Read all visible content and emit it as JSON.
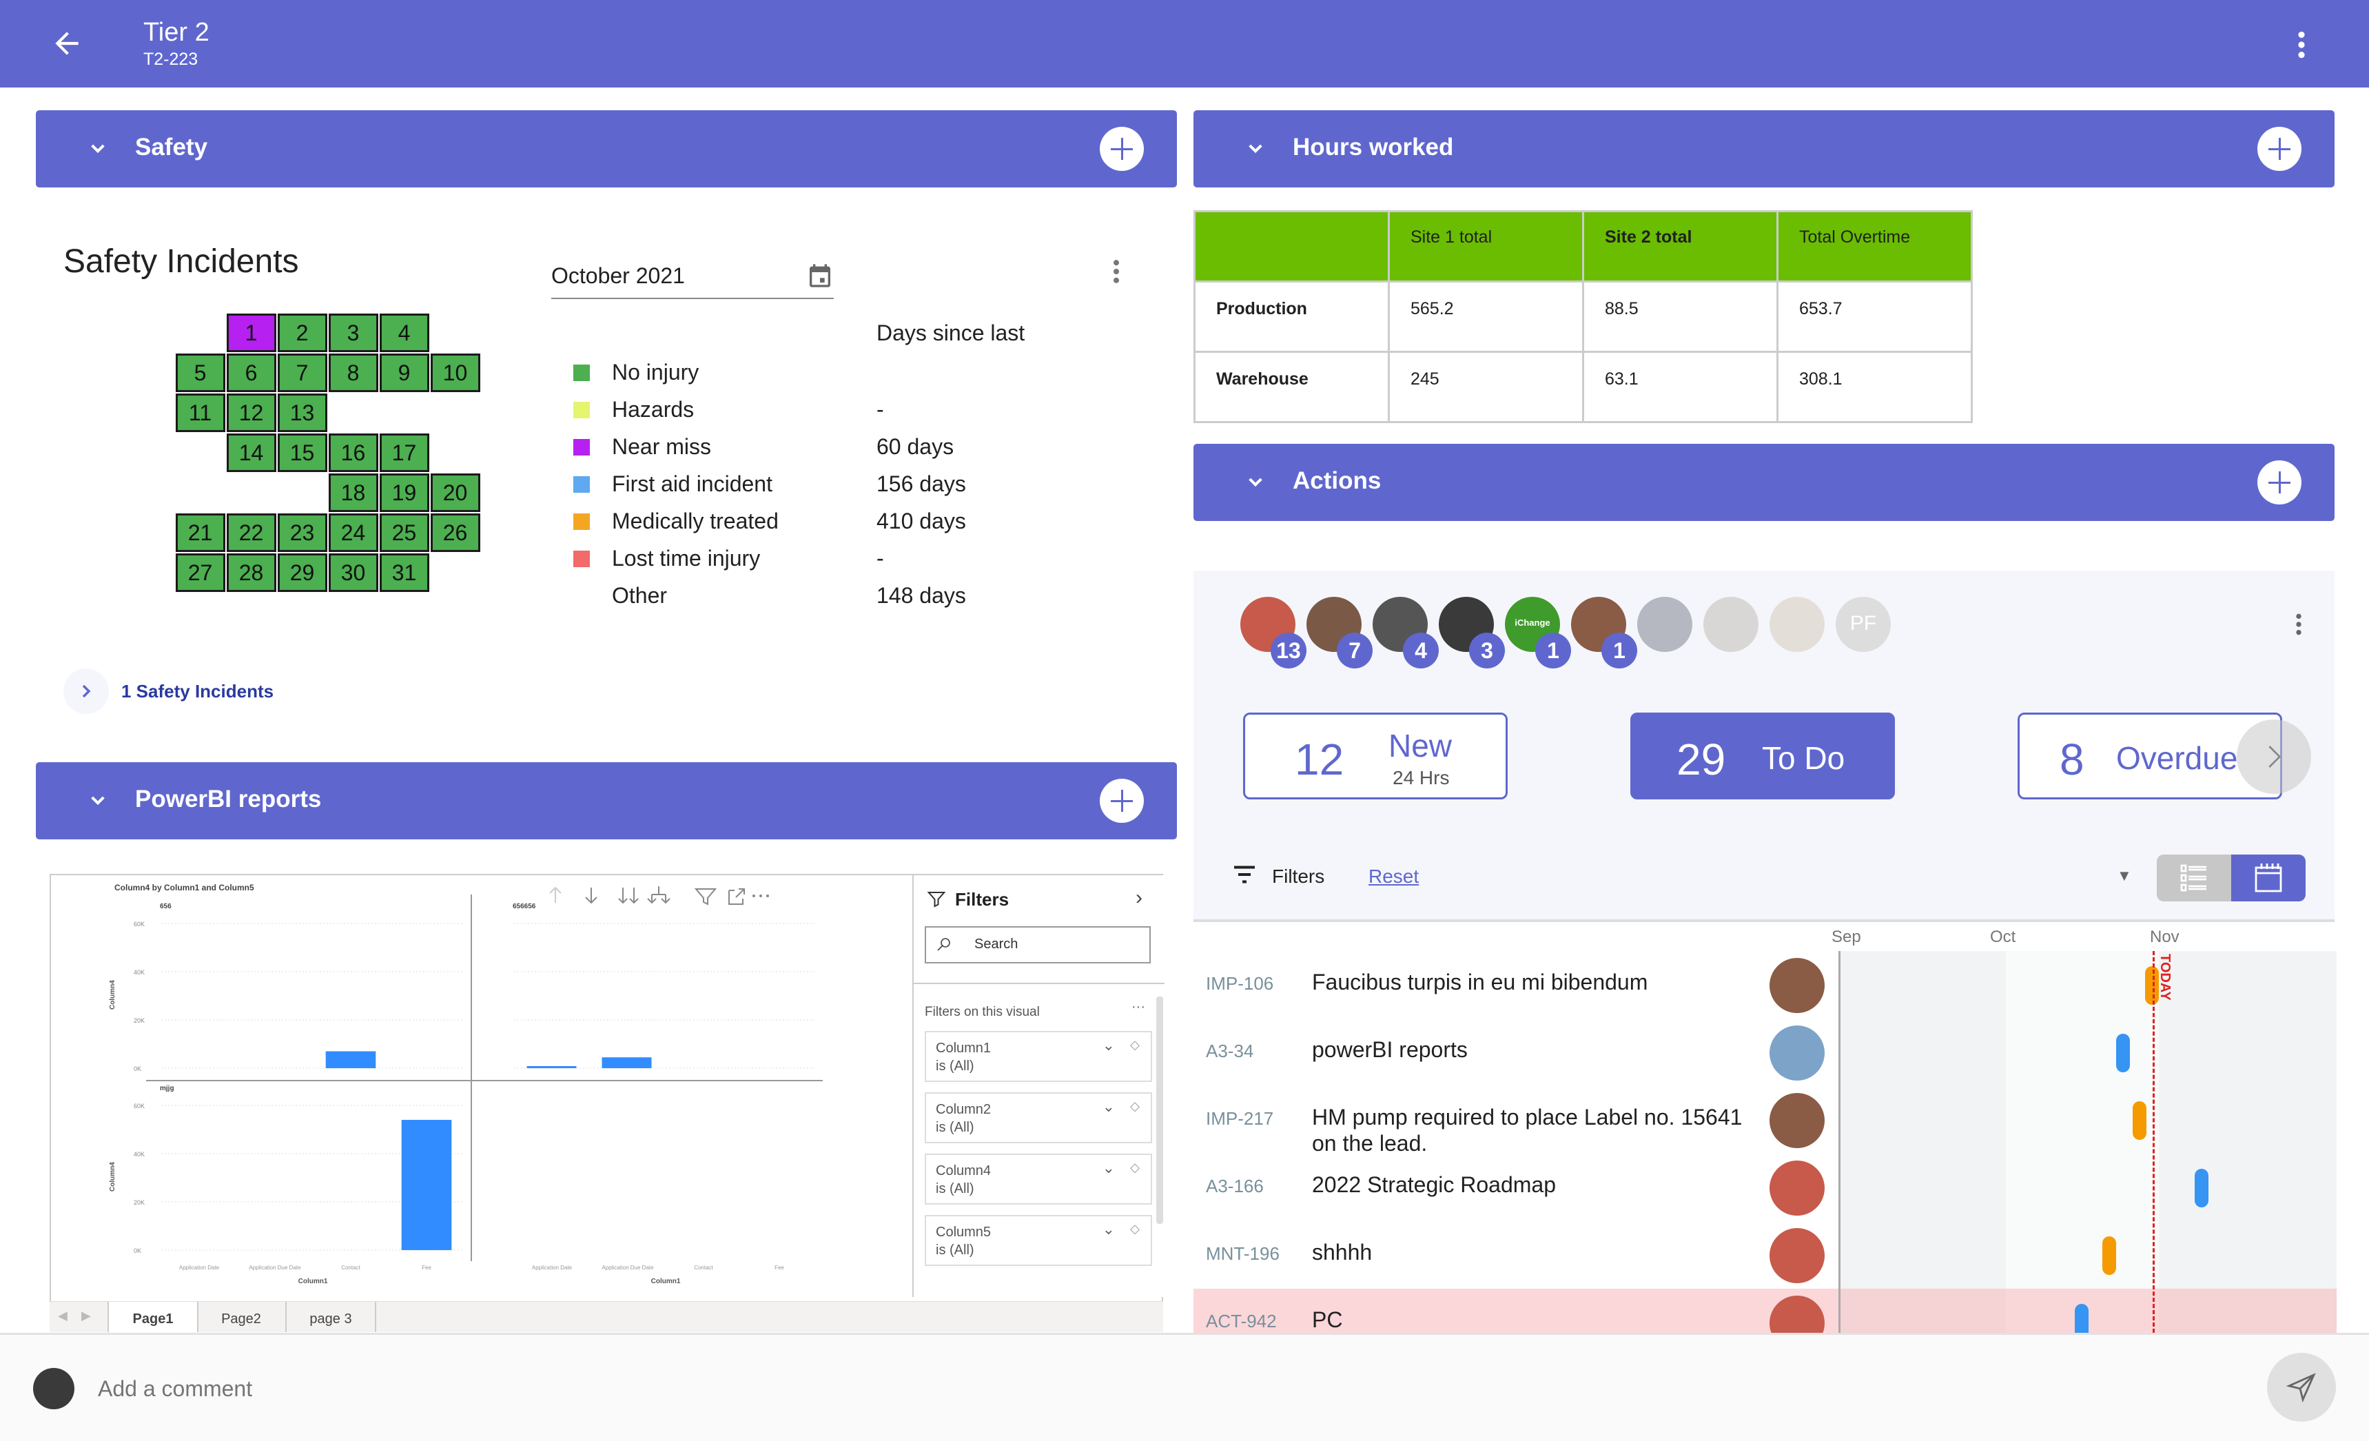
{
  "header": {
    "title": "Tier 2",
    "subtitle": "T2-223"
  },
  "sections": {
    "safety": "Safety",
    "hours": "Hours worked",
    "powerbi": "PowerBI reports",
    "actions": "Actions"
  },
  "safety": {
    "title": "Safety Incidents",
    "month": "October 2021",
    "days_since_header": "Days since last",
    "legend": [
      {
        "name": "No injury",
        "color": "#4caf50",
        "days": ""
      },
      {
        "name": "Hazards",
        "color": "#e6f56e",
        "days": "-"
      },
      {
        "name": "Near miss",
        "color": "#b620f0",
        "days": "60 days"
      },
      {
        "name": "First aid incident",
        "color": "#5ea9ef",
        "days": "156 days"
      },
      {
        "name": "Medically treated",
        "color": "#f4a623",
        "days": "410 days"
      },
      {
        "name": "Lost time injury",
        "color": "#f26a6a",
        "days": "-"
      },
      {
        "name": "Other",
        "color": "",
        "days": "148 days"
      }
    ],
    "days": [
      "1",
      "2",
      "3",
      "4",
      "5",
      "6",
      "7",
      "8",
      "9",
      "10",
      "11",
      "12",
      "13",
      "14",
      "15",
      "16",
      "17",
      "18",
      "19",
      "20",
      "21",
      "22",
      "23",
      "24",
      "25",
      "26",
      "27",
      "28",
      "29",
      "30",
      "31"
    ],
    "highlighted_day": {
      "day": "1",
      "category": "Near miss"
    },
    "incidents_link": "1 Safety Incidents"
  },
  "hours_table": {
    "headers": [
      "",
      "Site 1 total",
      "Site 2 total",
      "Total Overtime"
    ],
    "rows": [
      [
        "Production",
        "565.2",
        "88.5",
        "653.7"
      ],
      [
        "Warehouse",
        "245",
        "63.1",
        "308.1"
      ]
    ]
  },
  "powerbi": {
    "chart_data": {
      "type": "bar",
      "title": "Column4 by Column1 and Column5",
      "xlabel": "Column1",
      "ylabel": "Column4",
      "categories": [
        "Application Date",
        "Application Due Date",
        "Contact",
        "Fee"
      ],
      "y_ticks": [
        "0K",
        "20K",
        "40K",
        "60K"
      ],
      "ylim": [
        0,
        60000
      ],
      "panels": [
        {
          "name": "656",
          "values": [
            0,
            0,
            7000,
            0
          ]
        },
        {
          "name": "656656",
          "values": [
            300,
            4500,
            0,
            0
          ]
        },
        {
          "name": "mjjg",
          "values": [
            0,
            0,
            0,
            54000
          ]
        }
      ]
    },
    "filters_title": "Filters",
    "search_placeholder": "Search",
    "filters_on_visual": "Filters on this visual",
    "filters": [
      {
        "name": "Column1",
        "state": "is (All)"
      },
      {
        "name": "Column2",
        "state": "is (All)"
      },
      {
        "name": "Column4",
        "state": "is (All)"
      },
      {
        "name": "Column5",
        "state": "is (All)"
      }
    ],
    "pages": [
      "Page1",
      "Page2",
      "page 3"
    ],
    "active_page": "Page1"
  },
  "actions": {
    "avatars": [
      {
        "count": "13",
        "color": "#c75a4a"
      },
      {
        "count": "7",
        "color": "#7a5a46"
      },
      {
        "count": "4",
        "color": "#555555"
      },
      {
        "count": "3",
        "color": "#3a3a3a"
      },
      {
        "count": "1",
        "color": "#3f9b2b",
        "label": "iChange"
      },
      {
        "count": "1",
        "color": "#8a5b45"
      },
      {
        "count": "",
        "color": "#8b8f99"
      },
      {
        "count": "",
        "color": "#c7c3bd"
      },
      {
        "count": "",
        "color": "#d9cfc2"
      },
      {
        "count": "",
        "color": "#dddddd",
        "initials": "PF"
      }
    ],
    "stats": {
      "new": {
        "count": "12",
        "label": "New",
        "sub": "24 Hrs"
      },
      "todo": {
        "count": "29",
        "label": "To Do"
      },
      "overdue": {
        "count": "8",
        "label": "Overdue"
      }
    },
    "filters_label": "Filters",
    "reset_label": "Reset",
    "months": [
      "Sep",
      "Oct",
      "Nov"
    ],
    "today_label": "TODAY",
    "items": [
      {
        "id": "IMP-106",
        "title": "Faucibus turpis in eu mi bibendum",
        "avatar": "#8a5b45",
        "bar_color": "#f59b00",
        "highlight": false
      },
      {
        "id": "A3-34",
        "title": "powerBI reports",
        "avatar": "#7da3c9",
        "bar_color": "#3694f3",
        "highlight": false
      },
      {
        "id": "IMP-217",
        "title": "HM pump required to place Label no. 15641 on the lead.",
        "avatar": "#8a5b45",
        "bar_color": "#f59b00",
        "highlight": false
      },
      {
        "id": "A3-166",
        "title": "2022 Strategic Roadmap",
        "avatar": "#c75a4a",
        "bar_color": "#3694f3",
        "highlight": false
      },
      {
        "id": "MNT-196",
        "title": "shhhh",
        "avatar": "#c75a4a",
        "bar_color": "#f59b00",
        "highlight": false
      },
      {
        "id": "ACT-942",
        "title": "PC",
        "avatar": "#c75a4a",
        "bar_color": "#3694f3",
        "highlight": true
      }
    ]
  },
  "comment": {
    "placeholder": "Add a comment"
  }
}
